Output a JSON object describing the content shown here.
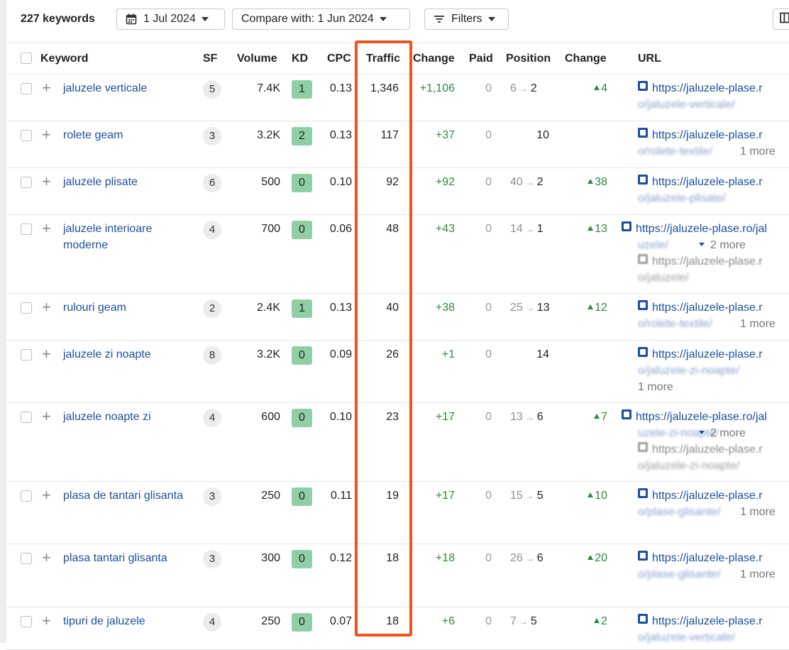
{
  "toolbar": {
    "keyword_count": "227 keywords",
    "date_label": "1 Jul 2024",
    "compare_label": "Compare with: 1 Jun 2024",
    "filters_label": "Filters"
  },
  "columns": {
    "keyword": "Keyword",
    "sf": "SF",
    "volume": "Volume",
    "kd": "KD",
    "cpc": "CPC",
    "traffic": "Traffic",
    "change": "Change",
    "paid": "Paid",
    "position": "Position",
    "pos_change": "Change",
    "url": "URL"
  },
  "rows": [
    {
      "keyword": "jaluzele verticale",
      "sf": "5",
      "volume": "7.4K",
      "kd": "1",
      "cpc": "0.13",
      "traffic": "1,346",
      "change": "+1,106",
      "paid": "0",
      "pos_from": "6",
      "pos_to": "2",
      "pos_change": "4",
      "url": "https://jaluzele-plase.r",
      "url_blur": "o/jaluzele-verticale/",
      "more": ""
    },
    {
      "keyword": "rolete geam",
      "sf": "3",
      "volume": "3.2K",
      "kd": "2",
      "cpc": "0.13",
      "traffic": "117",
      "change": "+37",
      "paid": "0",
      "pos_from": "",
      "pos_to": "10",
      "pos_change": "",
      "url": "https://jaluzele-plase.r",
      "url_blur": "o/rolete-textile/",
      "more": "1 more"
    },
    {
      "keyword": "jaluzele plisate",
      "sf": "6",
      "volume": "500",
      "kd": "0",
      "cpc": "0.10",
      "traffic": "92",
      "change": "+92",
      "paid": "0",
      "pos_from": "40",
      "pos_to": "2",
      "pos_change": "38",
      "url": "https://jaluzele-plase.r",
      "url_blur": "o/jaluzele-plisate/",
      "more": ""
    },
    {
      "keyword": "jaluzele interioare moderne",
      "sf": "4",
      "volume": "700",
      "kd": "0",
      "cpc": "0.06",
      "traffic": "48",
      "change": "+43",
      "paid": "0",
      "pos_from": "14",
      "pos_to": "1",
      "pos_change": "13",
      "url": "https://jaluzele-plase.ro/jal",
      "url_blur": "uzele/",
      "more": "2 more",
      "url2": "https://jaluzele-plase.r",
      "url2_blur": "o/jaluzele/"
    },
    {
      "keyword": "rulouri geam",
      "sf": "2",
      "volume": "2.4K",
      "kd": "1",
      "cpc": "0.13",
      "traffic": "40",
      "change": "+38",
      "paid": "0",
      "pos_from": "25",
      "pos_to": "13",
      "pos_change": "12",
      "url": "https://jaluzele-plase.r",
      "url_blur": "o/rolete-textile/",
      "more": "1 more"
    },
    {
      "keyword": "jaluzele zi noapte",
      "sf": "8",
      "volume": "3.2K",
      "kd": "0",
      "cpc": "0.09",
      "traffic": "26",
      "change": "+1",
      "paid": "0",
      "pos_from": "",
      "pos_to": "14",
      "pos_change": "",
      "url": "https://jaluzele-plase.r",
      "url_blur": "o/jaluzele-zi-noapte/",
      "more": "1 more"
    },
    {
      "keyword": "jaluzele noapte zi",
      "sf": "4",
      "volume": "600",
      "kd": "0",
      "cpc": "0.10",
      "traffic": "23",
      "change": "+17",
      "paid": "0",
      "pos_from": "13",
      "pos_to": "6",
      "pos_change": "7",
      "url": "https://jaluzele-plase.ro/jal",
      "url_blur": "uzele-zi-noapte/",
      "more": "2 more",
      "url2": "https://jaluzele-plase.r",
      "url2_blur": "o/jaluzele-zi-noapte/"
    },
    {
      "keyword": "plasa de tantari glisanta",
      "sf": "3",
      "volume": "250",
      "kd": "0",
      "cpc": "0.11",
      "traffic": "19",
      "change": "+17",
      "paid": "0",
      "pos_from": "15",
      "pos_to": "5",
      "pos_change": "10",
      "url": "https://jaluzele-plase.r",
      "url_blur": "o/plase-glisante/",
      "more": "1 more"
    },
    {
      "keyword": "plasa tantari glisanta",
      "sf": "3",
      "volume": "300",
      "kd": "0",
      "cpc": "0.12",
      "traffic": "18",
      "change": "+18",
      "paid": "0",
      "pos_from": "26",
      "pos_to": "6",
      "pos_change": "20",
      "url": "https://jaluzele-plase.r",
      "url_blur": "o/plase-glisante/",
      "more": "1 more"
    },
    {
      "keyword": "tipuri de jaluzele",
      "sf": "4",
      "volume": "250",
      "kd": "0",
      "cpc": "0.07",
      "traffic": "18",
      "change": "+6",
      "paid": "0",
      "pos_from": "7",
      "pos_to": "5",
      "pos_change": "2",
      "url": "https://jaluzele-plase.r",
      "url_blur": "o/jaluzele-verticale/",
      "more": ""
    }
  ],
  "colors": {
    "link": "#1c4fa0",
    "positive": "#2c8a3f",
    "kd_badge": "#90cfa5",
    "highlight": "#f0531b"
  },
  "icons": {
    "date": "calendar-icon",
    "filters": "filter-icon",
    "row_add": "plus-icon",
    "url": "page-icon"
  }
}
